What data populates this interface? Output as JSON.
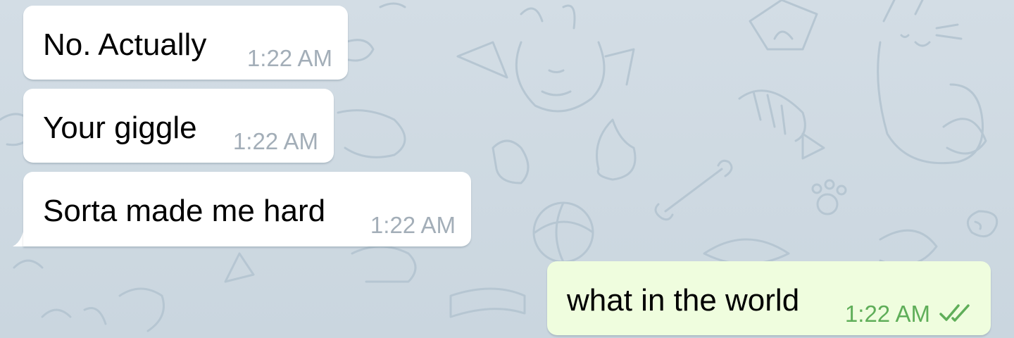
{
  "messages": [
    {
      "direction": "in",
      "text": "No. Actually",
      "time": "1:22 AM"
    },
    {
      "direction": "in",
      "text": "Your giggle",
      "time": "1:22 AM"
    },
    {
      "direction": "in",
      "text": "Sorta made me hard",
      "time": "1:22 AM"
    },
    {
      "direction": "out",
      "text": "what in the world",
      "time": "1:22 AM",
      "status_icon": "double-check-icon"
    }
  ],
  "colors": {
    "incoming_bubble": "#ffffff",
    "outgoing_bubble": "#effdde",
    "incoming_time": "#a3aeb8",
    "outgoing_time": "#5fae59",
    "chat_background": "#cfdae3"
  }
}
